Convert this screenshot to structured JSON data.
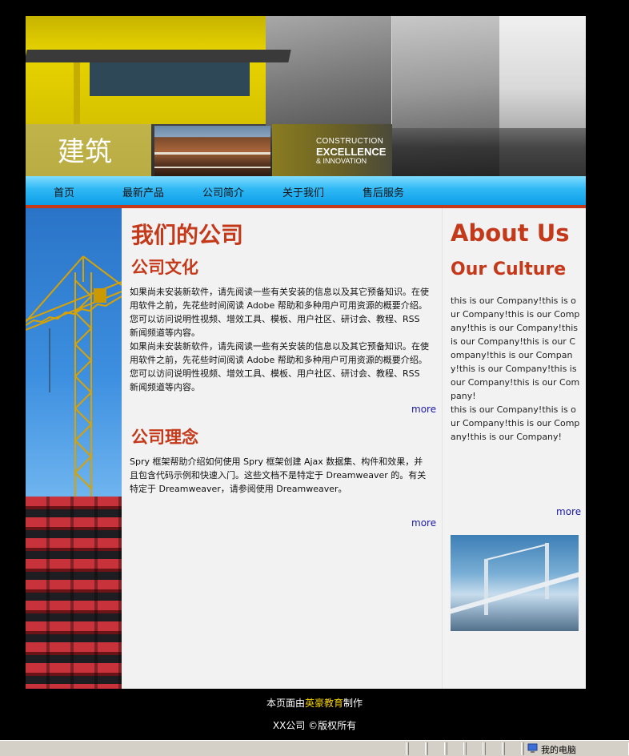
{
  "header": {
    "title": "建筑",
    "tagline": [
      "CONSTRUCTION",
      "EXCELLENCE",
      "& INNOVATION"
    ]
  },
  "nav": {
    "items": [
      "首页",
      "最新产品",
      "公司简介",
      "关于我们",
      "售后服务"
    ]
  },
  "main": {
    "heading": "我们的公司",
    "section1": {
      "title": "公司文化",
      "para1": "如果尚未安装新软件，请先阅读一些有关安装的信息以及其它预备知识。在使用软件之前，先花些时间阅读 Adobe 帮助和多种用户可用资源的概要介绍。您可以访问说明性视频、增效工具、模板、用户社区、研讨会、教程、RSS 新闻频道等内容。",
      "para2": "如果尚未安装新软件，请先阅读一些有关安装的信息以及其它预备知识。在使用软件之前，先花些时间阅读 Adobe 帮助和多种用户可用资源的概要介绍。您可以访问说明性视频、增效工具、模板、用户社区、研讨会、教程、RSS 新闻频道等内容。",
      "more": "more"
    },
    "section2": {
      "title": "公司理念",
      "para": "Spry 框架帮助介绍如何使用 Spry 框架创建 Ajax 数据集、构件和效果，并且包含代码示例和快速入门。这些文档不是特定于 Dreamweaver 的。有关特定于 Dreamweaver，请参阅使用 Dreamweaver。",
      "more": "more"
    }
  },
  "sidebar": {
    "heading": "About Us",
    "subheading": "Our Culture",
    "text": "this is our Company!this is our Company!this is our Company!this is our Company!this is our Company!this is our Company!this is our Company!this is our Company!this is our Company!this is our Company!\nthis is our Company!this is our Company!this is our Company!this is our Company!",
    "more": "more"
  },
  "footer": {
    "line1_prefix": "本页面由",
    "line1_highlight": "英豪教育",
    "line1_suffix": "制作",
    "line2": "XX公司 ©版权所有"
  },
  "statusbar": {
    "zone": "我的电脑"
  },
  "colors": {
    "accent": "#c4391a",
    "nav": "#0d9ee8",
    "link": "#1a1aa8",
    "footer_highlight": "#f5d20a"
  },
  "icons": [
    "computer-icon"
  ]
}
